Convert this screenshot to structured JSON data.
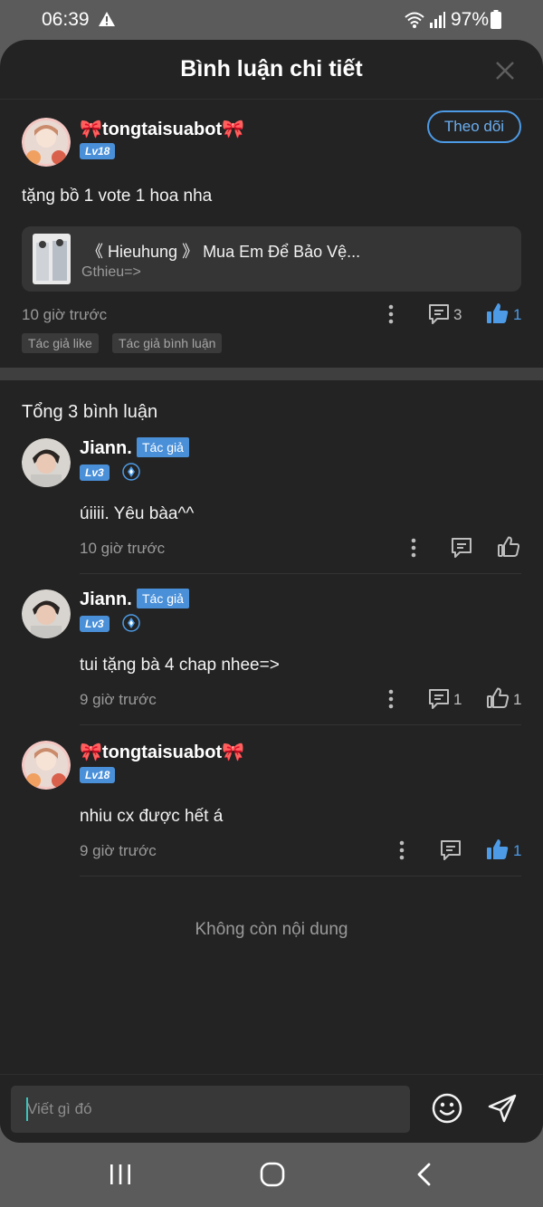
{
  "status_bar": {
    "time": "06:39",
    "battery": "97%"
  },
  "sheet": {
    "title": "Bình luận chi tiết"
  },
  "main_comment": {
    "username": "🎀tongtaisuabot🎀",
    "level": "Lv18",
    "follow_label": "Theo dõi",
    "text": "tặng bồ 1 vote 1 hoa nha",
    "book": {
      "title": "《 Hieuhung 》 Mua Em Để Bảo Vệ...",
      "subtitle": "Gthieu=>"
    },
    "time": "10 giờ trước",
    "reply_count": "3",
    "like_count": "1",
    "tags": [
      "Tác giả like",
      "Tác giả bình luận"
    ]
  },
  "total_label": "Tổng 3 bình luận",
  "replies": [
    {
      "username": "Jiann.",
      "author_tag": "Tác giả",
      "level": "Lv3",
      "text": "úiiii. Yêu bàa^^",
      "time": "10 giờ trước",
      "reply_count": "",
      "like_count": ""
    },
    {
      "username": "Jiann.",
      "author_tag": "Tác giả",
      "level": "Lv3",
      "text": "tui tặng bà 4 chap nhee=>",
      "time": "9 giờ trước",
      "reply_count": "1",
      "like_count": "1"
    },
    {
      "username": "🎀tongtaisuabot🎀",
      "level": "Lv18",
      "text": "nhiu cx được hết á",
      "time": "9 giờ trước",
      "reply_count": "",
      "like_count": "1"
    }
  ],
  "end_text": "Không còn nội dung",
  "input": {
    "placeholder": "Viết gì đó"
  },
  "colors": {
    "accent": "#4d9be6",
    "background": "#232323",
    "badge": "#4a90d9"
  }
}
